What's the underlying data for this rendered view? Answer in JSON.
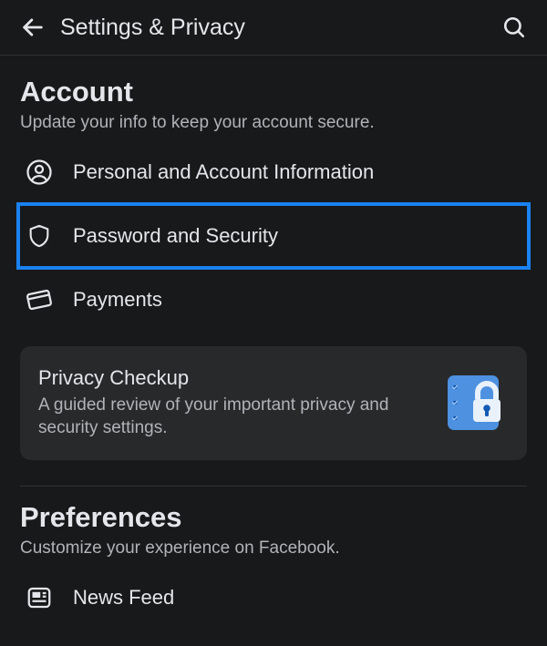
{
  "header": {
    "title": "Settings & Privacy"
  },
  "account": {
    "title": "Account",
    "subtitle": "Update your info to keep your account secure.",
    "items": [
      {
        "label": "Personal and Account Information"
      },
      {
        "label": "Password and Security"
      },
      {
        "label": "Payments"
      }
    ]
  },
  "privacy_checkup": {
    "title": "Privacy Checkup",
    "subtitle": "A guided review of your important privacy and security settings."
  },
  "preferences": {
    "title": "Preferences",
    "subtitle": "Customize your experience on Facebook.",
    "items": [
      {
        "label": "News Feed"
      }
    ]
  },
  "colors": {
    "highlight": "#1a82f2",
    "bg": "#18191a",
    "text_primary": "#e4e6eb",
    "text_secondary": "#b0b3b8"
  }
}
